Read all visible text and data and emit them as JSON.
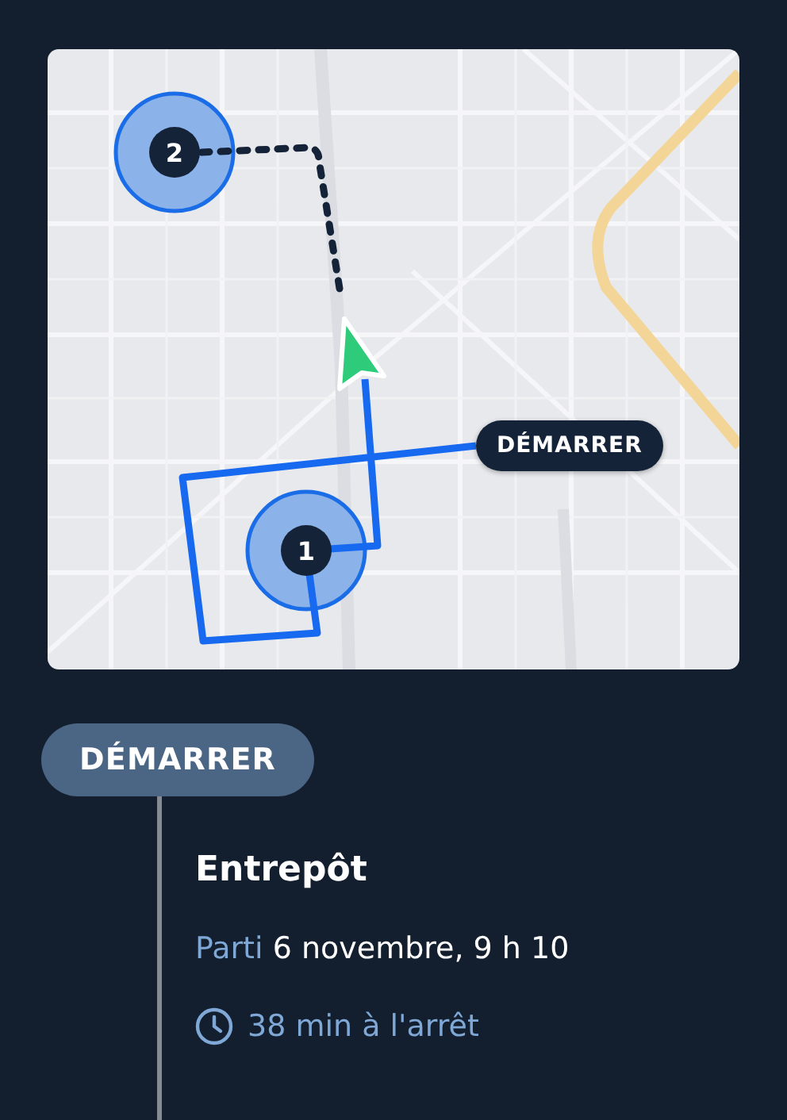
{
  "map": {
    "start_label": "DÉMARRER",
    "stops": [
      {
        "label": "1"
      },
      {
        "label": "2"
      }
    ]
  },
  "timeline": {
    "badge": "DÉMARRER",
    "stop": {
      "name": "Entrepôt",
      "status": "Parti",
      "time": "6 novembre, 9 h 10",
      "duration": "38 min à l'arrêt"
    }
  }
}
